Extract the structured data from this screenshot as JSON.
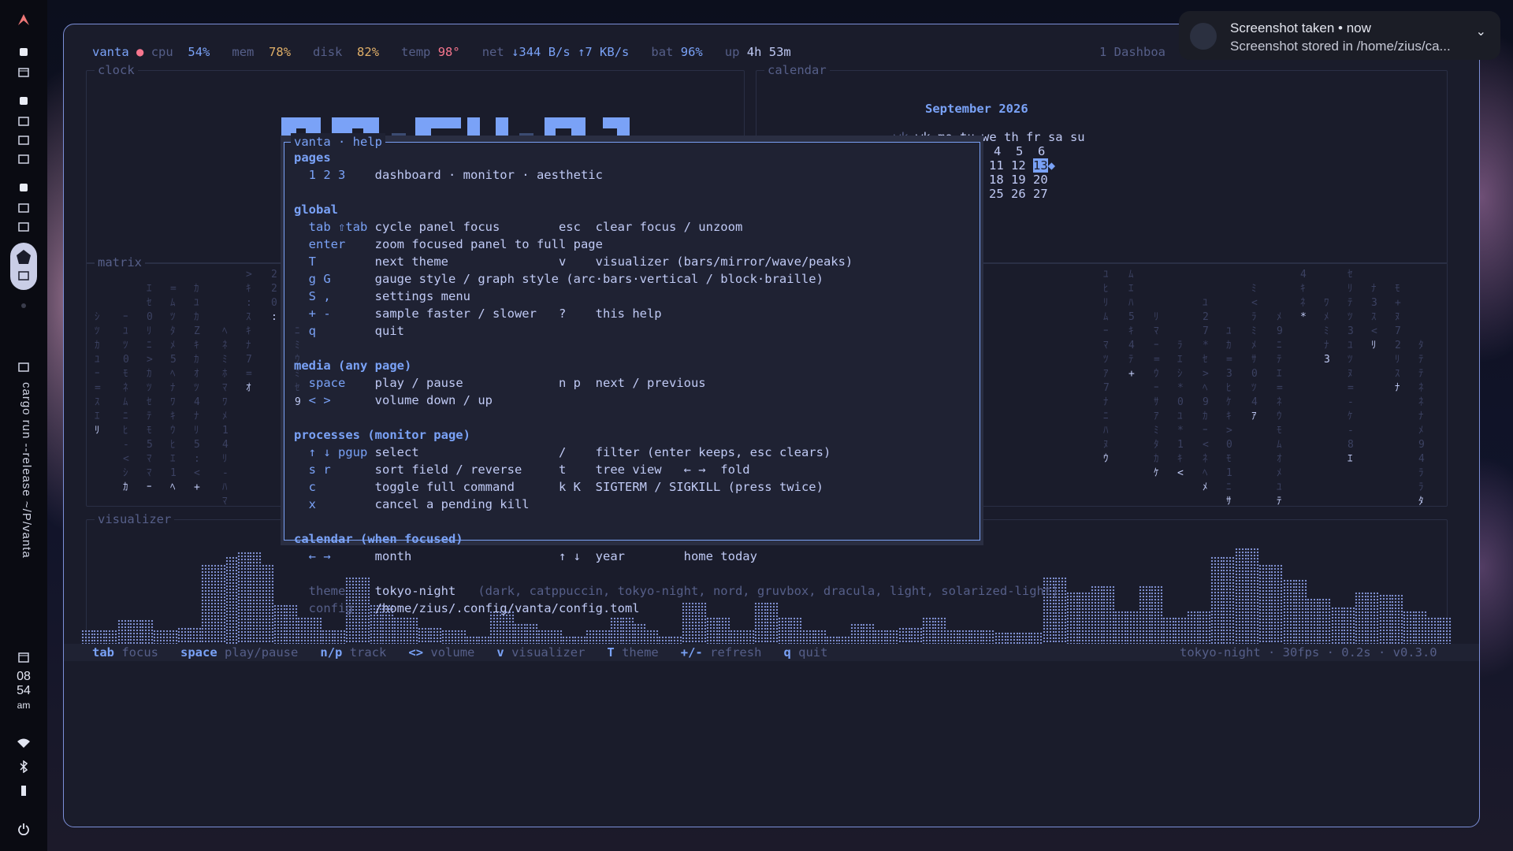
{
  "status": {
    "host": "vanta",
    "cpu_label": "cpu",
    "cpu_value": "54%",
    "mem_label": "mem",
    "mem_value": "78%",
    "disk_label": "disk",
    "disk_value": "82%",
    "temp_label": "temp",
    "temp_value": "98°",
    "net_label": "net",
    "net_down": "↓344 B/s",
    "net_up": "↑7 KB/s",
    "bat_label": "bat",
    "bat_value": "96%",
    "up_label": "up",
    "up_value": "4h 53m",
    "tabs": "1 Dashboa"
  },
  "panels": {
    "clock": "clock",
    "calendar": "calendar",
    "matrix": "matrix",
    "visualizer": "visualizer"
  },
  "calendar": {
    "month": "September 2026",
    "header": "wk mo tu we th fr sa su",
    "rows": [
      "4  5  6",
      "11 12",
      "18 19 20",
      "25 26 27"
    ],
    "today": "13"
  },
  "help": {
    "title": "vanta · help",
    "sections": {
      "pages": "pages",
      "global": "global",
      "media": "media (any page)",
      "processes": "processes (monitor page)",
      "calendar": "calendar (when focused)"
    },
    "lines": {
      "pages_keys": "1 2 3",
      "pages_desc": "dashboard · monitor · aesthetic",
      "g1_keys": "tab ⇧tab",
      "g1_desc": "cycle panel focus",
      "g1_keys2": "esc",
      "g1_desc2": "clear focus / unzoom",
      "g2_keys": "enter",
      "g2_desc": "zoom focused panel to full page",
      "g3_keys": "T",
      "g3_desc": "next theme",
      "g3_keys2": "v",
      "g3_desc2": "visualizer (bars/mirror/wave/peaks)",
      "g4_keys": "g G",
      "g4_desc": "gauge style / graph style (arc·bars·vertical / block·braille)",
      "g5_keys": "S ,",
      "g5_desc": "settings menu",
      "g6_keys": "+ -",
      "g6_desc": "sample faster / slower",
      "g6_keys2": "?",
      "g6_desc2": "this help",
      "g7_keys": "q",
      "g7_desc": "quit",
      "m1_keys": "space",
      "m1_desc": "play / pause",
      "m1_keys2": "n p",
      "m1_desc2": "next / previous",
      "m2_keys": "< >",
      "m2_desc": "volume down / up",
      "p1_keys": "↑ ↓ pgup",
      "p1_desc": "select",
      "p1_keys2": "/",
      "p1_desc2": "filter (enter keeps, esc clears)",
      "p2_keys": "s r",
      "p2_desc": "sort field / reverse",
      "p2_keys2": "t",
      "p2_desc2": "tree view   ← →  fold",
      "p3_keys": "c",
      "p3_desc": "toggle full command",
      "p3_keys2": "k K",
      "p3_desc2": "SIGTERM / SIGKILL (press twice)",
      "p4_keys": "x",
      "p4_desc": "cancel a pending kill",
      "c1_keys": "← →",
      "c1_desc": "month",
      "c1_keys2": "↑ ↓",
      "c1_desc2": "year",
      "c1_extra": "home today",
      "theme_label": "theme",
      "theme_value": "tokyo-night",
      "theme_options": "(dark, catppuccin, tokyo-night, nord, gruvbox, dracula, light, solarized-light)",
      "config_label": "config",
      "config_value": "/home/zius/.config/vanta/config.toml"
    }
  },
  "footer": {
    "k1": "tab",
    "d1": "focus",
    "k2": "space",
    "d2": "play/pause",
    "k3": "n/p",
    "d3": "track",
    "k4": "<>",
    "d4": "volume",
    "k5": "v",
    "d5": "visualizer",
    "k6": "T",
    "d6": "theme",
    "k7": "+/-",
    "d7": "refresh",
    "k8": "q",
    "d8": "quit",
    "right": "tokyo-night · 30fps · 0.2s · v0.3.0"
  },
  "notification": {
    "title": "Screenshot taken • now",
    "body": "Screenshot stored in /home/zius/ca..."
  },
  "dock": {
    "task": "cargo run --release ~/P/vanta",
    "hour": "08",
    "minute": "54",
    "ampm": "am"
  },
  "visualizer_levels": [
    0.2,
    0.2,
    0.2,
    0.28,
    0.28,
    0.28,
    0.2,
    0.2,
    0.22,
    0.22,
    0.72,
    0.72,
    0.78,
    0.82,
    0.82,
    0.72,
    0.4,
    0.4,
    0.3,
    0.3,
    0.2,
    0.2,
    0.62,
    0.62,
    0.4,
    0.4,
    0.3,
    0.3,
    0.22,
    0.22,
    0.2,
    0.2,
    0.15,
    0.15,
    0.35,
    0.35,
    0.25,
    0.25,
    0.2,
    0.2,
    0.15,
    0.15,
    0.2,
    0.2,
    0.3,
    0.3,
    0.25,
    0.2,
    0.15,
    0.15,
    0.42,
    0.42,
    0.3,
    0.3,
    0.2,
    0.2,
    0.42,
    0.42,
    0.3,
    0.3,
    0.2,
    0.2,
    0.15,
    0.15,
    0.25,
    0.25,
    0.2,
    0.2,
    0.22,
    0.22,
    0.3,
    0.3,
    0.2,
    0.2,
    0.2,
    0.2,
    0.18,
    0.18,
    0.18,
    0.18,
    0.62,
    0.62,
    0.5,
    0.5,
    0.55,
    0.55,
    0.35,
    0.35,
    0.55,
    0.55,
    0.3,
    0.3,
    0.35,
    0.35,
    0.78,
    0.78,
    0.85,
    0.85,
    0.72,
    0.72,
    0.6,
    0.6,
    0.45,
    0.45,
    0.38,
    0.38,
    0.5,
    0.5,
    0.48,
    0.48,
    0.35,
    0.35,
    0.3,
    0.3
  ]
}
